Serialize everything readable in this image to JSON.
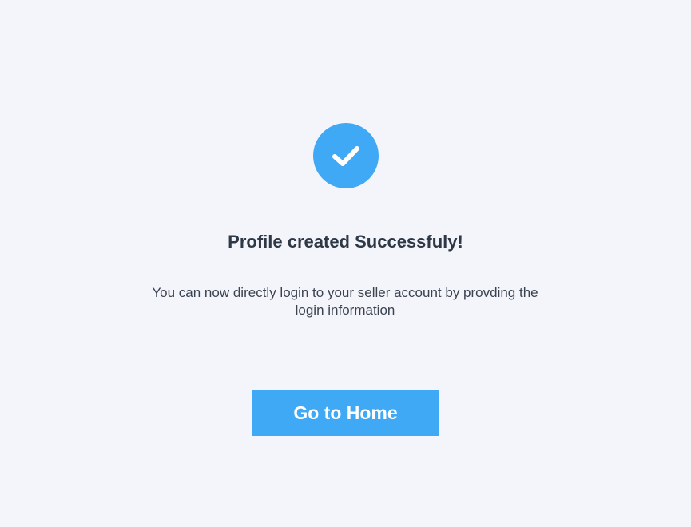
{
  "success": {
    "icon": "check-icon",
    "accent_color": "#3fa9f5",
    "title": "Profile created Successfuly!",
    "message": "You can now directly login to your seller account by provding the login information"
  },
  "actions": {
    "home_label": "Go to Home"
  }
}
